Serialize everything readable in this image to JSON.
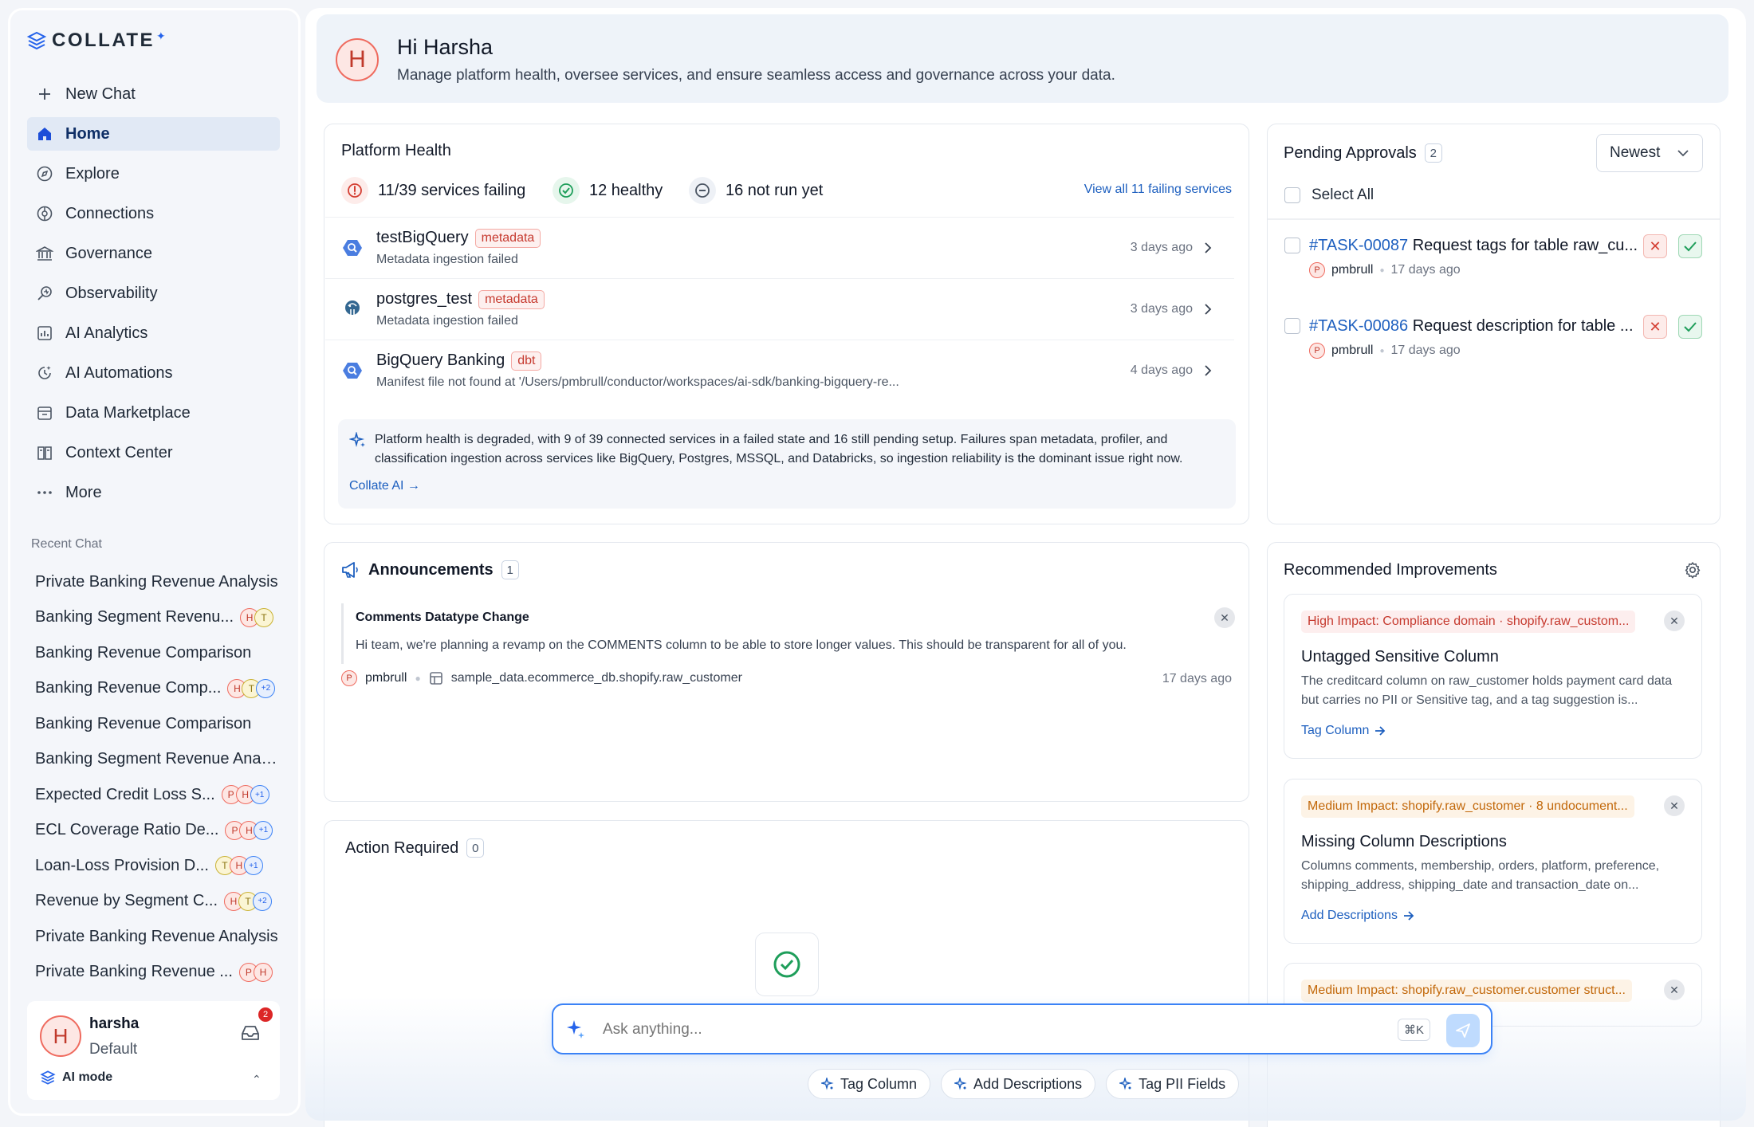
{
  "app": {
    "logo_text": "COLLATE"
  },
  "sidebar": {
    "nav": [
      {
        "label": "New Chat",
        "icon": "plus-icon"
      },
      {
        "label": "Home",
        "icon": "home-icon",
        "active": true
      },
      {
        "label": "Explore",
        "icon": "compass-icon"
      },
      {
        "label": "Connections",
        "icon": "connections-icon"
      },
      {
        "label": "Governance",
        "icon": "bank-icon"
      },
      {
        "label": "Observability",
        "icon": "observability-icon"
      },
      {
        "label": "AI Analytics",
        "icon": "analytics-icon"
      },
      {
        "label": "AI Automations",
        "icon": "automation-icon"
      },
      {
        "label": "Data Marketplace",
        "icon": "marketplace-icon"
      },
      {
        "label": "Context Center",
        "icon": "book-icon"
      },
      {
        "label": "More",
        "icon": "more-icon"
      }
    ],
    "recent_label": "Recent Chat",
    "recent": [
      {
        "title": "Private Banking Revenue Analysis",
        "avatars": []
      },
      {
        "title": "Banking Segment Revenu...",
        "avatars": [
          "H",
          "T"
        ]
      },
      {
        "title": "Banking Revenue Comparison",
        "avatars": []
      },
      {
        "title": "Banking Revenue Comp...",
        "avatars": [
          "H",
          "T",
          "+2"
        ]
      },
      {
        "title": "Banking Revenue Comparison",
        "avatars": []
      },
      {
        "title": "Banking Segment Revenue Analy...",
        "avatars": []
      },
      {
        "title": "Expected Credit Loss S...",
        "avatars": [
          "P",
          "H",
          "+1"
        ]
      },
      {
        "title": "ECL Coverage Ratio De...",
        "avatars": [
          "P",
          "H",
          "+1"
        ]
      },
      {
        "title": "Loan-Loss Provision D...",
        "avatars": [
          "T",
          "H",
          "+1"
        ]
      },
      {
        "title": "Revenue by Segment C...",
        "avatars": [
          "H",
          "T",
          "+2"
        ]
      },
      {
        "title": "Private Banking Revenue Analysis",
        "avatars": []
      },
      {
        "title": "Private Banking Revenue ...",
        "avatars": [
          "P",
          "H"
        ]
      }
    ],
    "user": {
      "initial": "H",
      "name": "harsha",
      "role": "Default",
      "inbox_count": "2",
      "mode_label": "AI mode"
    }
  },
  "hero": {
    "avatar": "H",
    "greeting": "Hi Harsha",
    "subtitle": "Manage platform health, oversee services, and ensure seamless access and governance across your data."
  },
  "platform_health": {
    "title": "Platform Health",
    "failing": "11/39 services failing",
    "healthy": "12 healthy",
    "not_run": "16 not run yet",
    "view_all": "View all 11 failing services",
    "services": [
      {
        "name": "testBigQuery",
        "tag": "metadata",
        "desc": "Metadata ingestion failed",
        "ago": "3 days ago",
        "icon": "bigquery-icon"
      },
      {
        "name": "postgres_test",
        "tag": "metadata",
        "desc": "Metadata ingestion failed",
        "ago": "3 days ago",
        "icon": "postgres-icon"
      },
      {
        "name": "BigQuery Banking",
        "tag": "dbt",
        "desc": "Manifest file not found at '/Users/pmbrull/conductor/workspaces/ai-sdk/banking-bigquery-re...",
        "ago": "4 days ago",
        "icon": "bigquery-icon"
      }
    ],
    "ai_summary": "Platform health is degraded, with 9 of 39 connected services in a failed state and 16 still pending setup. Failures span metadata, profiler, and classification ingestion across services like BigQuery, Postgres, MSSQL, and Databricks, so ingestion reliability is the dominant issue right now.",
    "ai_link": "Collate AI →"
  },
  "pending": {
    "title": "Pending Approvals",
    "count": "2",
    "sort": "Newest",
    "select_all": "Select All",
    "tasks": [
      {
        "id": "#TASK-00087",
        "text": "Request tags for table raw_cu...",
        "user_initial": "P",
        "user": "pmbrull",
        "ago": "17 days ago"
      },
      {
        "id": "#TASK-00086",
        "text": "Request description for table ...",
        "user_initial": "P",
        "user": "pmbrull",
        "ago": "17 days ago"
      }
    ]
  },
  "announcements": {
    "title": "Announcements",
    "count": "1",
    "item": {
      "title": "Comments Datatype Change",
      "body": "Hi team, we're planning a revamp on the COMMENTS column to be able to store longer values. This should be transparent for all of you.",
      "user_initial": "P",
      "user": "pmbrull",
      "asset": "sample_data.ecommerce_db.shopify.raw_customer",
      "ago": "17 days ago"
    }
  },
  "action_required": {
    "title": "Action Required",
    "count": "0"
  },
  "recommended": {
    "title": "Recommended Improvements",
    "items": [
      {
        "impact": "High Impact: Compliance domain · shopify.raw_custom...",
        "level": "high",
        "title": "Untagged Sensitive Column",
        "desc": "The creditcard column on raw_customer holds payment card data but carries no PII or Sensitive tag, and a tag suggestion is...",
        "link": "Tag Column"
      },
      {
        "impact": "Medium Impact: shopify.raw_customer · 8 undocument...",
        "level": "med",
        "title": "Missing Column Descriptions",
        "desc": "Columns comments, membership, orders, platform, preference, shipping_address, shipping_date and transaction_date on...",
        "link": "Add Descriptions"
      },
      {
        "impact": "Medium Impact: shopify.raw_customer.customer struct...",
        "level": "med"
      }
    ]
  },
  "chat": {
    "placeholder": "Ask anything...",
    "shortcut": "⌘K",
    "chips": [
      "Tag Column",
      "Add Descriptions",
      "Tag PII Fields"
    ]
  },
  "colors": {
    "accent": "#1d5fbf",
    "danger": "#d43f33",
    "success": "#1e9e5a",
    "sidebar_bg": "#f4f6fa"
  }
}
